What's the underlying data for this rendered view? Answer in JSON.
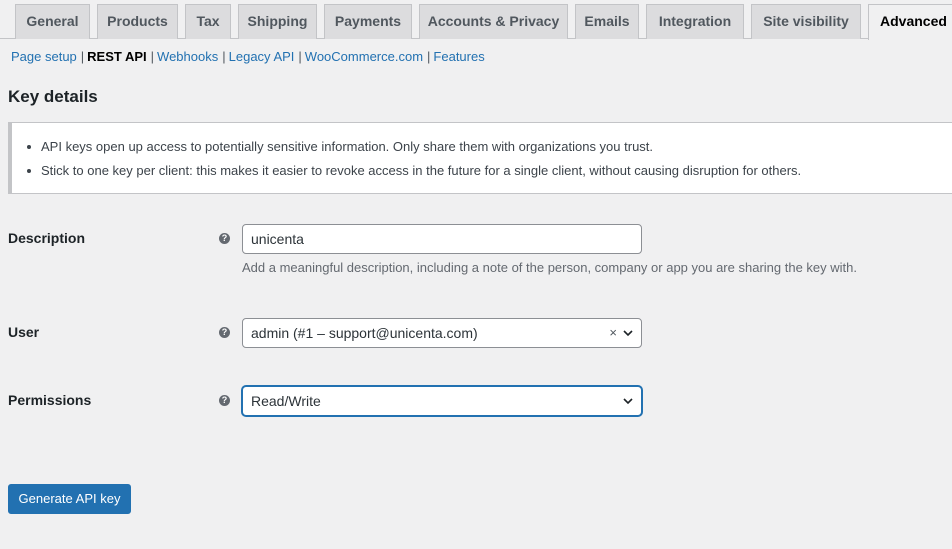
{
  "tabs": [
    {
      "label": "General"
    },
    {
      "label": "Products"
    },
    {
      "label": "Tax"
    },
    {
      "label": "Shipping"
    },
    {
      "label": "Payments"
    },
    {
      "label": "Accounts & Privacy"
    },
    {
      "label": "Emails"
    },
    {
      "label": "Integration"
    },
    {
      "label": "Site visibility"
    },
    {
      "label": "Advanced",
      "active": true
    }
  ],
  "subnav": [
    {
      "label": "Page setup"
    },
    {
      "label": "REST API",
      "current": true
    },
    {
      "label": "Webhooks"
    },
    {
      "label": "Legacy API"
    },
    {
      "label": "WooCommerce.com"
    },
    {
      "label": "Features"
    }
  ],
  "subnav_separator": "|",
  "section_title": "Key details",
  "notice": {
    "items": [
      "API keys open up access to potentially sensitive information. Only share them with organizations you trust.",
      "Stick to one key per client: this makes it easier to revoke access in the future for a single client, without causing disruption for others."
    ]
  },
  "help_glyph": "?",
  "form": {
    "description": {
      "label": "Description",
      "value": "unicenta",
      "help_text": "Add a meaningful description, including a note of the person, company or app you are sharing the key with."
    },
    "user": {
      "label": "User",
      "value": "admin (#1 – support@unicenta.com)",
      "clear_glyph": "×"
    },
    "permissions": {
      "label": "Permissions",
      "value": "Read/Write"
    }
  },
  "generate_button": "Generate API key",
  "colors": {
    "accent": "#2271b1",
    "background": "#f0f0f1",
    "tab_inactive": "#dcdcde"
  }
}
